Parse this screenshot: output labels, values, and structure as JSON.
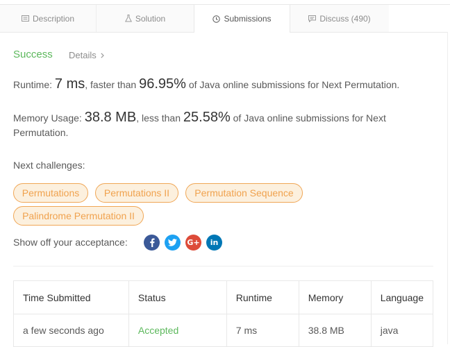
{
  "tabs": [
    {
      "label": "Description",
      "icon": "description-icon"
    },
    {
      "label": "Solution",
      "icon": "flask-icon"
    },
    {
      "label": "Submissions",
      "icon": "clock-icon",
      "active": true
    },
    {
      "label": "Discuss (490)",
      "icon": "comment-icon"
    }
  ],
  "result": {
    "status": "Success",
    "details": "Details",
    "runtime_prefix": "Runtime: ",
    "runtime_value": "7 ms",
    "runtime_mid": ", faster than ",
    "runtime_percent": "96.95%",
    "runtime_suffix": " of Java online submissions for Next Permutation.",
    "memory_prefix": "Memory Usage: ",
    "memory_value": "38.8 MB",
    "memory_mid": ", less than ",
    "memory_percent": "25.58%",
    "memory_suffix": " of Java online submissions for Next Permutation."
  },
  "next_challenges": {
    "label": "Next challenges:",
    "items": [
      "Permutations",
      "Permutations II",
      "Permutation Sequence",
      "Palindrome Permutation II"
    ]
  },
  "share": {
    "label": "Show off your acceptance:",
    "icons": [
      "facebook-icon",
      "twitter-icon",
      "google-plus-icon",
      "linkedin-icon"
    ]
  },
  "table": {
    "headers": [
      "Time Submitted",
      "Status",
      "Runtime",
      "Memory",
      "Language"
    ],
    "rows": [
      [
        "a few seconds ago",
        "Accepted",
        "7 ms",
        "38.8 MB",
        "java"
      ]
    ]
  },
  "colors": {
    "success": "#5cb85c",
    "tag_text": "#f0a24e",
    "tag_bg": "#fcf0de",
    "facebook": "#3b5998",
    "twitter": "#1da1f2",
    "google_plus": "#dd4b39",
    "linkedin": "#0077b5"
  }
}
